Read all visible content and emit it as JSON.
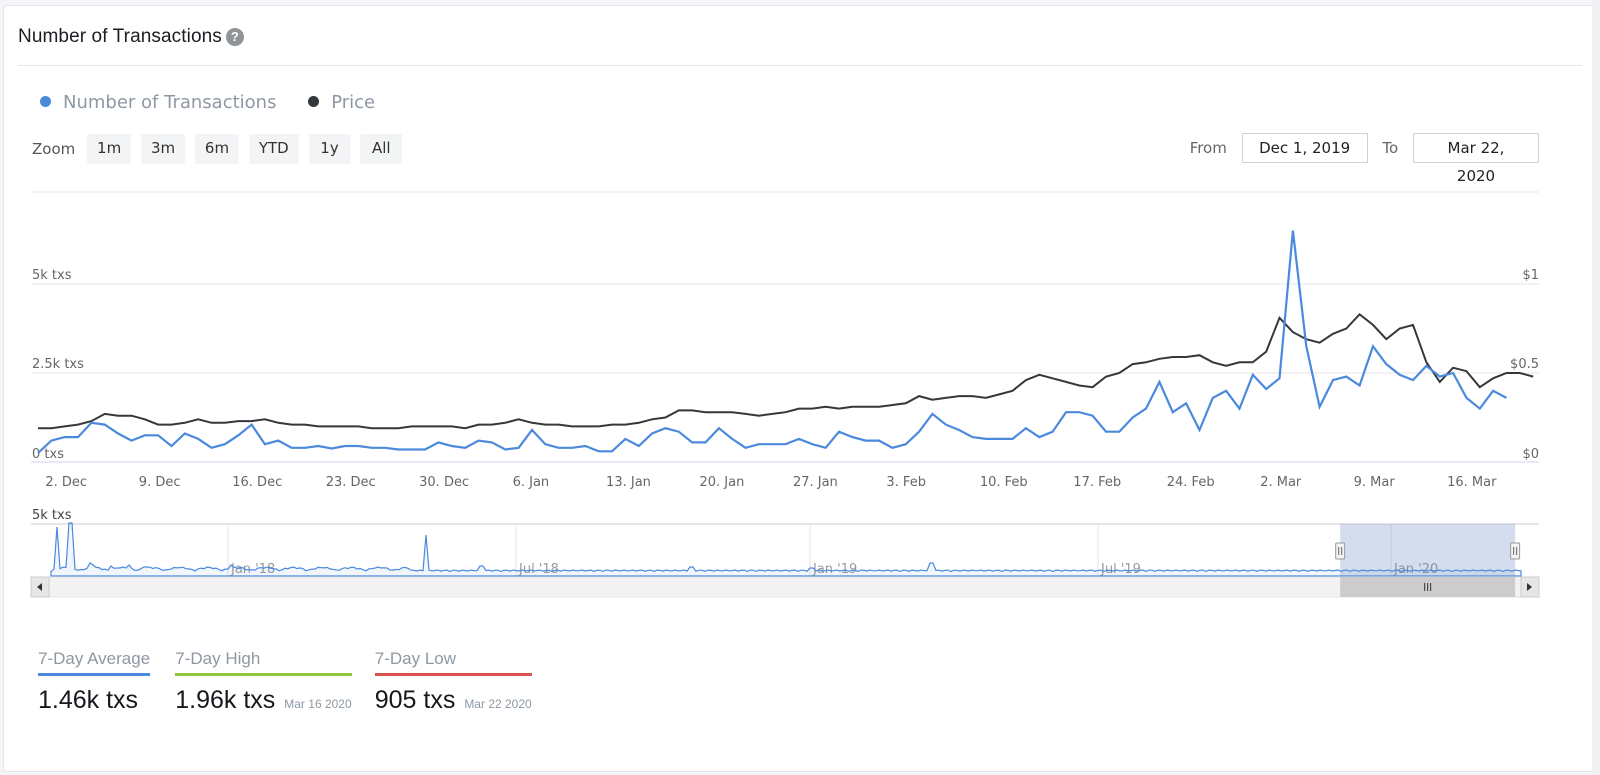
{
  "header": {
    "title": "Number of Transactions",
    "help_icon": "question-circle-icon"
  },
  "legend": [
    {
      "label": "Number of Transactions",
      "color": "#4a89dc"
    },
    {
      "label": "Price",
      "color": "#34373b"
    }
  ],
  "zoom": {
    "label": "Zoom",
    "buttons": [
      "1m",
      "3m",
      "6m",
      "YTD",
      "1y",
      "All"
    ]
  },
  "range": {
    "from_label": "From",
    "from_value": "Dec 1, 2019",
    "to_label": "To",
    "to_value": "Mar 22, 2020"
  },
  "navigator": {
    "y_label": "5k txs",
    "x_labels": [
      "Jan '18",
      "Jul '18",
      "Jan '19",
      "Jul '19",
      "Jan '20"
    ],
    "selection_start_fraction": 0.877,
    "selection_end_fraction": 0.996
  },
  "stats": [
    {
      "label": "7-Day Average",
      "value": "1.46k txs",
      "date": "",
      "color": "#4a89dc"
    },
    {
      "label": "7-Day High",
      "value": "1.96k txs",
      "date": "Mar 16 2020",
      "color": "#8cc63f"
    },
    {
      "label": "7-Day Low",
      "value": "905 txs",
      "date": "Mar 22 2020",
      "color": "#d9534f"
    }
  ],
  "chart_data": {
    "type": "line",
    "title": "Number of Transactions",
    "x_start": "2019-12-01",
    "x_end": "2020-03-22",
    "x_tick_labels": [
      "2. Dec",
      "9. Dec",
      "16. Dec",
      "23. Dec",
      "30. Dec",
      "6. Jan",
      "13. Jan",
      "20. Jan",
      "27. Jan",
      "3. Feb",
      "10. Feb",
      "17. Feb",
      "24. Feb",
      "2. Mar",
      "9. Mar",
      "16. Mar"
    ],
    "y_left": {
      "label": "",
      "ticks": [
        "0 txs",
        "2.5k txs",
        "5k txs"
      ],
      "range": [
        0,
        5000
      ]
    },
    "y_right": {
      "label": "",
      "ticks": [
        "$0",
        "$0.5",
        "$1"
      ],
      "range": [
        0,
        1
      ]
    },
    "grid": true,
    "legend_position": "top-left",
    "series": [
      {
        "name": "Number of Transactions",
        "axis": "left",
        "color": "#4a89dc",
        "values": [
          250,
          600,
          700,
          700,
          1100,
          1050,
          800,
          600,
          750,
          750,
          450,
          800,
          650,
          400,
          500,
          750,
          1050,
          500,
          600,
          400,
          400,
          450,
          380,
          450,
          450,
          400,
          400,
          350,
          350,
          350,
          550,
          450,
          400,
          600,
          550,
          350,
          400,
          900,
          500,
          400,
          400,
          450,
          300,
          300,
          650,
          450,
          800,
          950,
          850,
          550,
          550,
          950,
          650,
          400,
          500,
          500,
          500,
          650,
          500,
          400,
          850,
          700,
          600,
          600,
          400,
          500,
          850,
          1350,
          1050,
          900,
          700,
          650,
          650,
          650,
          950,
          700,
          850,
          1400,
          1400,
          1300,
          850,
          850,
          1250,
          1500,
          2250,
          1400,
          1650,
          900,
          1800,
          2000,
          1500,
          2450,
          2050,
          2350,
          6500,
          3250,
          1550,
          2300,
          2400,
          2150,
          3250,
          2750,
          2450,
          2300,
          2700,
          2400,
          2500,
          1800,
          1500,
          2000,
          1800
        ]
      },
      {
        "name": "Price",
        "axis": "right",
        "color": "#34373b",
        "values": [
          0.19,
          0.19,
          0.2,
          0.21,
          0.23,
          0.27,
          0.26,
          0.26,
          0.24,
          0.21,
          0.21,
          0.22,
          0.24,
          0.22,
          0.22,
          0.23,
          0.23,
          0.24,
          0.22,
          0.21,
          0.21,
          0.2,
          0.2,
          0.2,
          0.2,
          0.19,
          0.19,
          0.19,
          0.2,
          0.2,
          0.2,
          0.2,
          0.19,
          0.21,
          0.21,
          0.22,
          0.24,
          0.22,
          0.21,
          0.21,
          0.2,
          0.2,
          0.2,
          0.21,
          0.21,
          0.22,
          0.24,
          0.25,
          0.29,
          0.29,
          0.28,
          0.28,
          0.28,
          0.27,
          0.26,
          0.27,
          0.28,
          0.3,
          0.3,
          0.31,
          0.3,
          0.31,
          0.31,
          0.31,
          0.32,
          0.33,
          0.37,
          0.35,
          0.36,
          0.37,
          0.37,
          0.36,
          0.38,
          0.4,
          0.46,
          0.49,
          0.47,
          0.45,
          0.43,
          0.42,
          0.48,
          0.5,
          0.55,
          0.56,
          0.58,
          0.59,
          0.59,
          0.6,
          0.56,
          0.54,
          0.56,
          0.56,
          0.62,
          0.81,
          0.73,
          0.69,
          0.67,
          0.72,
          0.75,
          0.83,
          0.77,
          0.69,
          0.75,
          0.77,
          0.56,
          0.45,
          0.53,
          0.51,
          0.42,
          0.47,
          0.5,
          0.5,
          0.48
        ]
      }
    ]
  }
}
